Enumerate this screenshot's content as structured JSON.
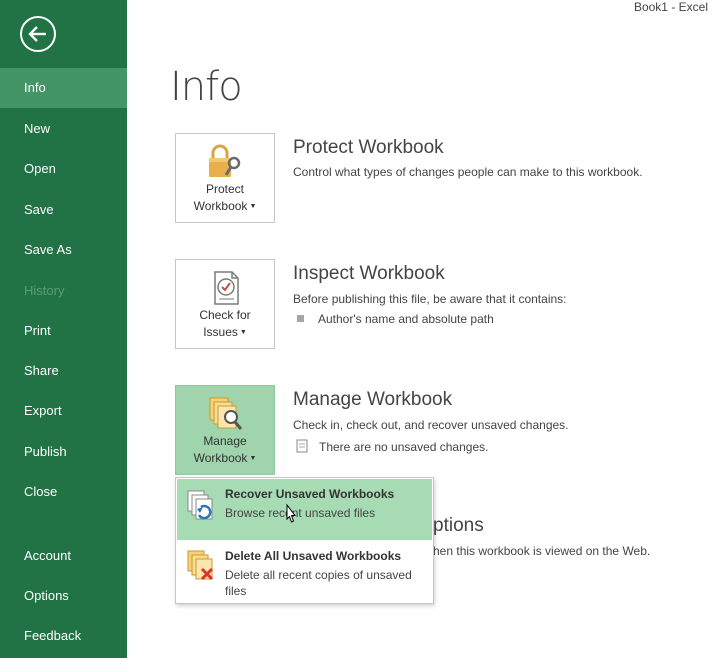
{
  "window": {
    "title": "Book1 - Excel"
  },
  "sidebar": {
    "items": [
      {
        "label": "Info",
        "selected": true,
        "enabled": true
      },
      {
        "label": "New",
        "enabled": true
      },
      {
        "label": "Open",
        "enabled": true
      },
      {
        "label": "Save",
        "enabled": true
      },
      {
        "label": "Save As",
        "enabled": true
      },
      {
        "label": "History",
        "enabled": false
      },
      {
        "label": "Print",
        "enabled": true
      },
      {
        "label": "Share",
        "enabled": true
      },
      {
        "label": "Export",
        "enabled": true
      },
      {
        "label": "Publish",
        "enabled": true
      },
      {
        "label": "Close",
        "enabled": true
      },
      {
        "label": "Account",
        "enabled": true
      },
      {
        "label": "Options",
        "enabled": true
      },
      {
        "label": "Feedback",
        "enabled": true
      }
    ]
  },
  "main": {
    "title": "Info",
    "protect": {
      "tile_line1": "Protect",
      "tile_line2": "Workbook",
      "heading": "Protect Workbook",
      "description": "Control what types of changes people can make to this workbook."
    },
    "inspect": {
      "tile_line1": "Check for",
      "tile_line2": "Issues",
      "heading": "Inspect Workbook",
      "description": "Before publishing this file, be aware that it contains:",
      "bullets": [
        "Author's name and absolute path"
      ]
    },
    "manage": {
      "tile_line1": "Manage",
      "tile_line2": "Workbook",
      "heading": "Manage Workbook",
      "description": "Check in, check out, and recover unsaved changes.",
      "status": "There are no unsaved changes."
    },
    "browser_view": {
      "heading_partial": "ptions",
      "description_partial": "hen this workbook is viewed on the Web."
    }
  },
  "manage_menu": {
    "items": [
      {
        "title": "Recover Unsaved Workbooks",
        "description": "Browse recent unsaved files",
        "hovered": true
      },
      {
        "title": "Delete All Unsaved Workbooks",
        "description": "Delete all recent copies of unsaved files"
      }
    ]
  },
  "colors": {
    "accent": "#217346",
    "selected_nav": "#439467",
    "hover_menu": "#a7dbb3",
    "active_tile": "#9fd4ad"
  },
  "icons": {
    "back": "back-arrow-circle-icon",
    "protect": "padlock-key-icon",
    "inspect": "check-document-icon",
    "manage": "workbook-magnifier-icon",
    "recover": "recover-documents-icon",
    "delete": "delete-documents-icon"
  }
}
